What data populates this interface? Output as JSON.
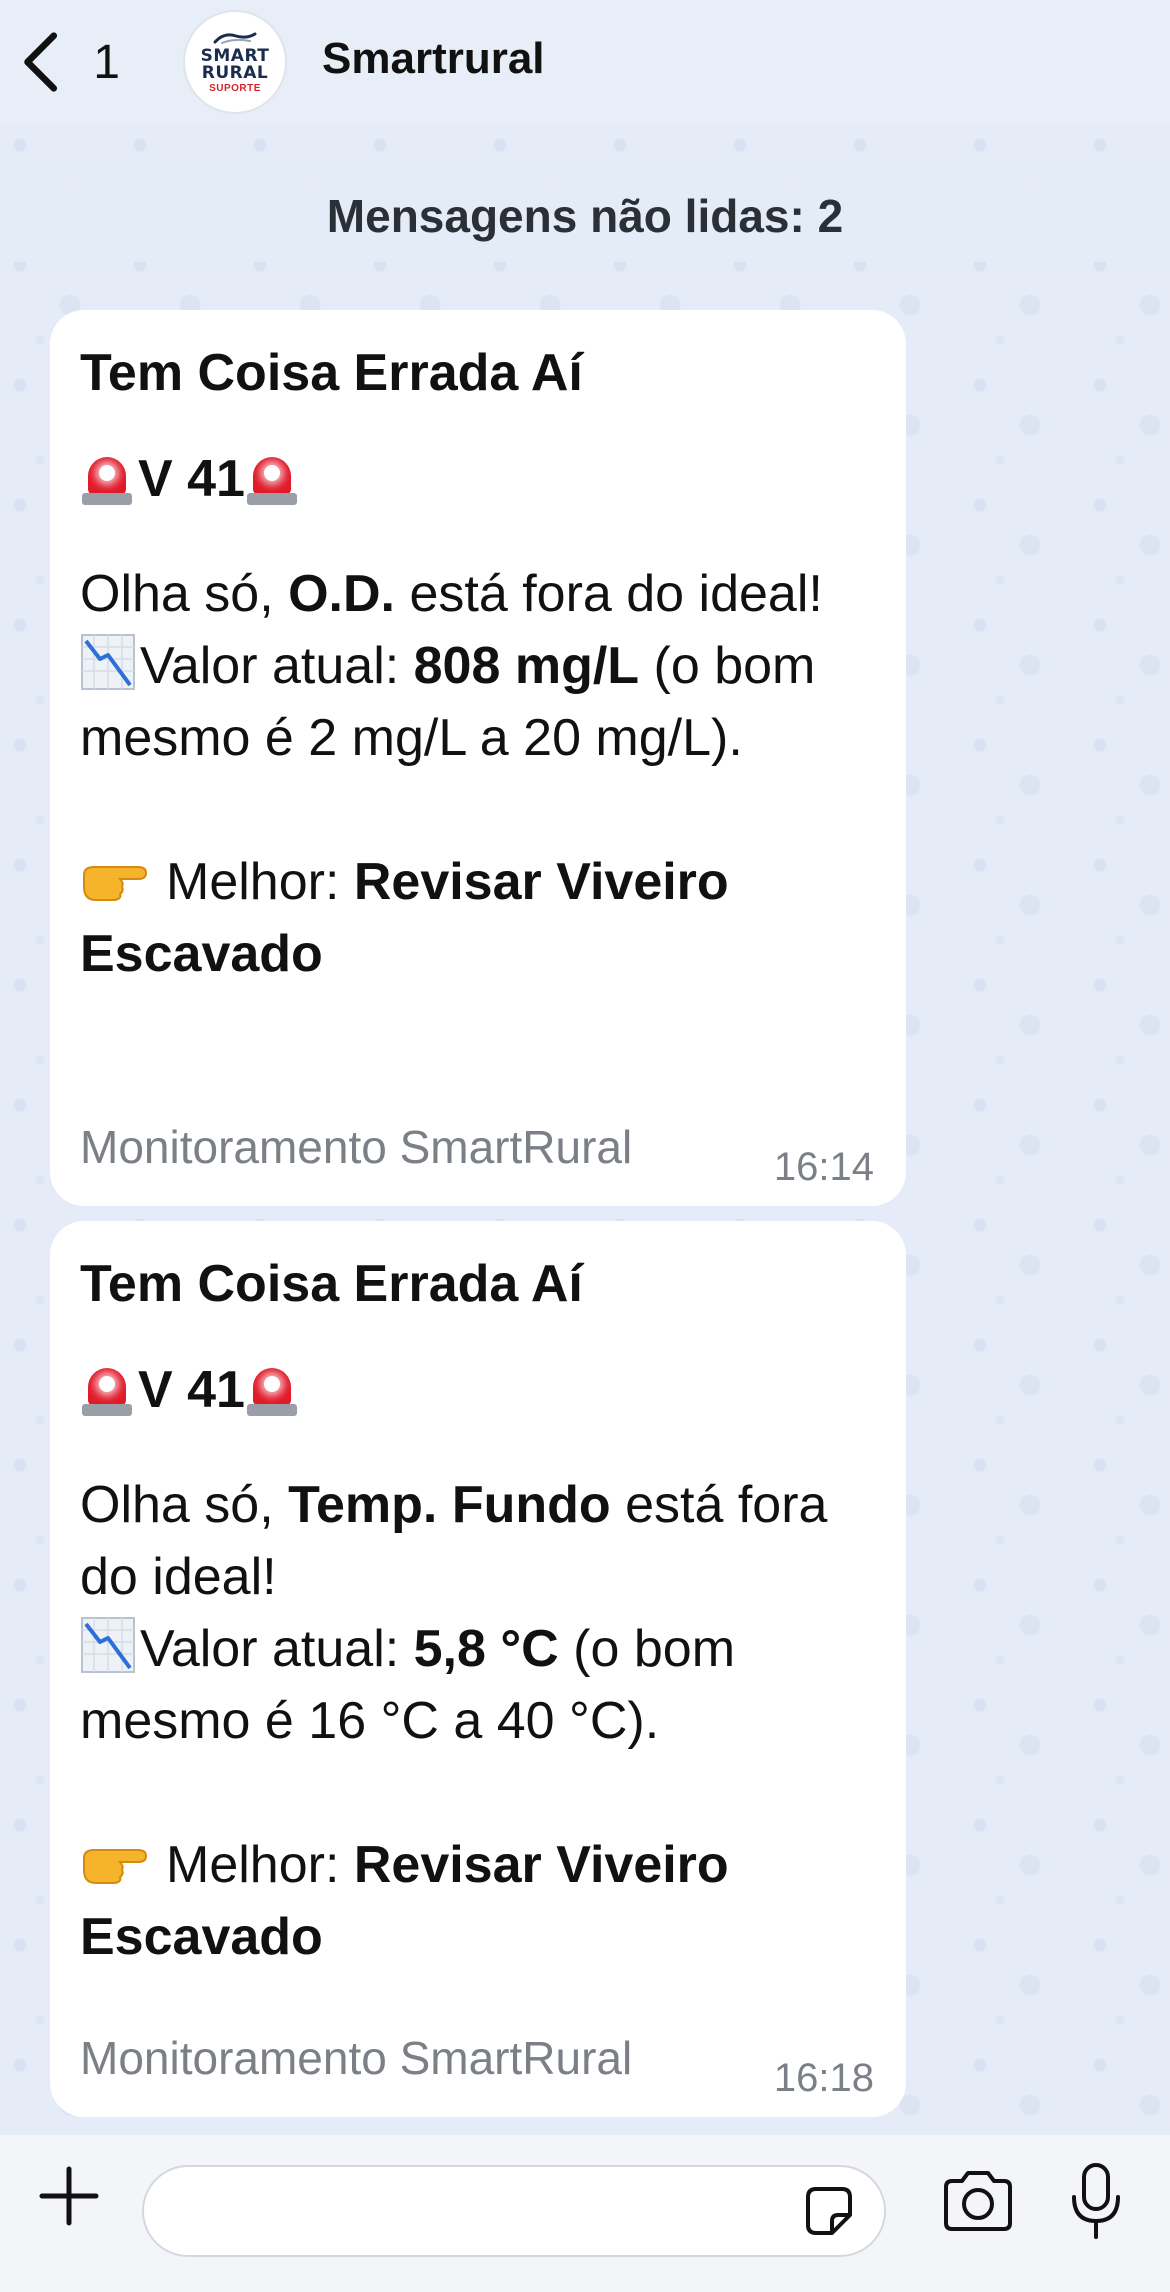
{
  "header": {
    "back_count": "1",
    "contact_name": "Smartrural",
    "avatar": {
      "line1": "SMART",
      "line2": "RURAL",
      "line3": "SUPORTE"
    }
  },
  "chat": {
    "unread_label": "Mensagens não lidas: 2",
    "messages": [
      {
        "title": "Tem Coisa Errada Aí",
        "vline": "V 41",
        "intro_pre": "Olha só, ",
        "param": "O.D.",
        "intro_post": " está fora do ideal!",
        "value_label": "Valor atual: ",
        "value": "808 mg/L",
        "range": " (o bom mesmo é 2 mg/L a 20 mg/L).",
        "reco_label": "Melhor: ",
        "reco_value": "Revisar Viveiro Escavado",
        "footer": "Monitoramento SmartRural",
        "time": "16:14"
      },
      {
        "title": "Tem Coisa Errada Aí",
        "vline": "V 41",
        "intro_pre": "Olha só, ",
        "param": "Temp. Fundo",
        "intro_post": " está fora do ideal!",
        "value_label": "Valor atual: ",
        "value": "5,8 °C",
        "range": " (o bom mesmo é 16 °C a 40 °C).",
        "reco_label": "Melhor: ",
        "reco_value": "Revisar Viveiro Escavado",
        "footer": "Monitoramento SmartRural",
        "time": "16:18"
      }
    ]
  },
  "composer": {
    "input_value": "",
    "icons": [
      "plus-icon",
      "sticker-icon",
      "camera-icon",
      "microphone-icon"
    ]
  },
  "colors": {
    "chat_background": "#e5ecf8",
    "bubble": "#ffffff",
    "siren_red": "#e11a2a",
    "muted_text": "#7b7f86"
  }
}
